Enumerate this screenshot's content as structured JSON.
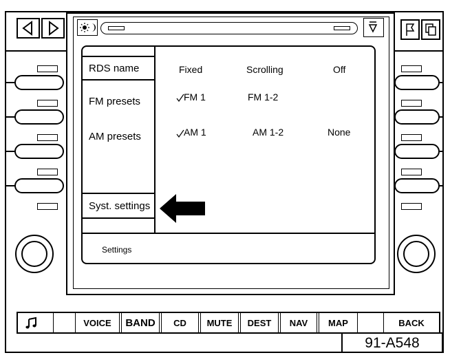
{
  "screen": {
    "menu": {
      "items": [
        {
          "label": "RDS name"
        },
        {
          "label": "FM presets"
        },
        {
          "label": "AM presets"
        },
        {
          "label": "Syst. settings"
        }
      ]
    },
    "rows": [
      {
        "c1": "Fixed",
        "c2": "Scrolling",
        "c3": "Off"
      },
      {
        "c1": "FM 1",
        "c2": "FM 1-2",
        "c3": ""
      },
      {
        "c1": "AM 1",
        "c2": "AM 1-2",
        "c3": "None"
      }
    ],
    "status_bar": "Settings"
  },
  "bottom_bar": {
    "buttons": [
      {
        "label": ""
      },
      {
        "label": ""
      },
      {
        "label": "VOICE"
      },
      {
        "label": "BAND"
      },
      {
        "label": "CD"
      },
      {
        "label": "MUTE"
      },
      {
        "label": "DEST"
      },
      {
        "label": "NAV"
      },
      {
        "label": "MAP"
      },
      {
        "label": ""
      },
      {
        "label": "BACK"
      }
    ]
  },
  "figure_id": "91-A548"
}
